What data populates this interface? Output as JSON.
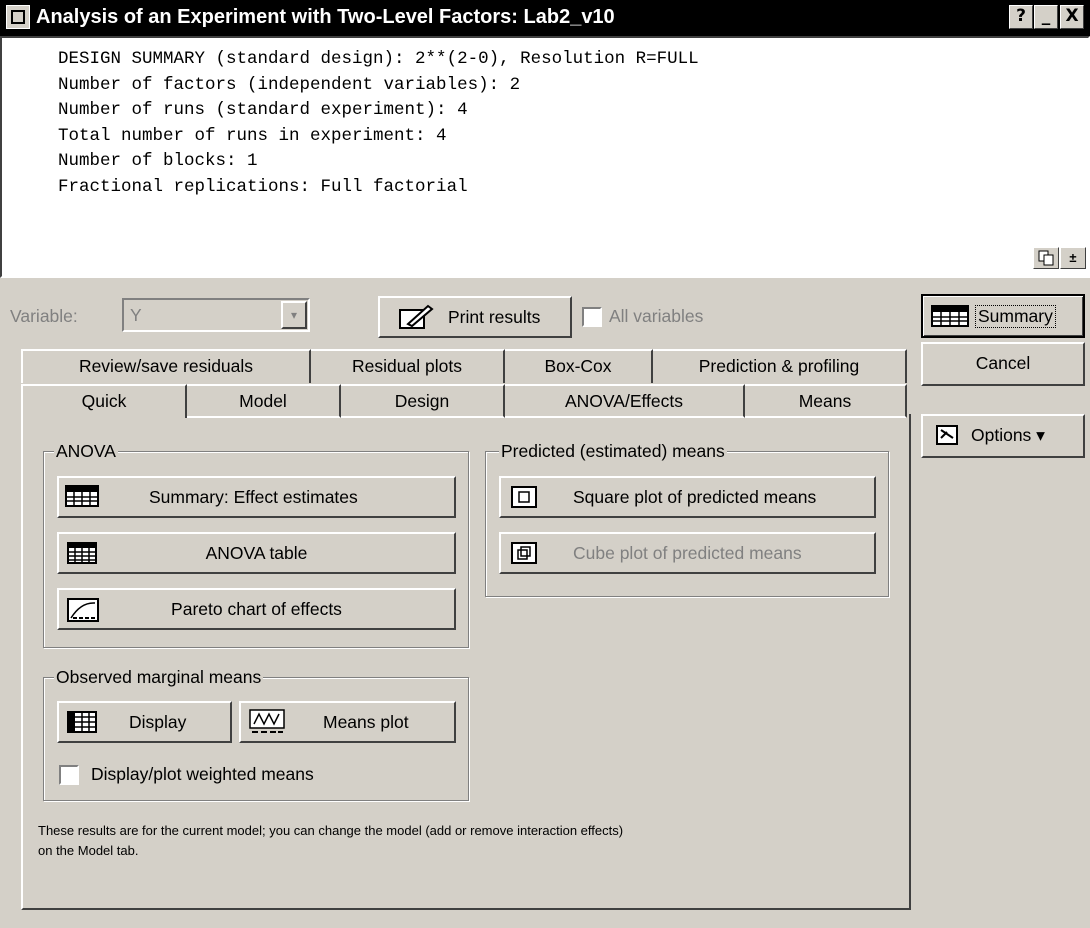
{
  "window": {
    "title": "Analysis of an Experiment with Two-Level Factors: Lab2_v10",
    "help_label": "?",
    "minimize_label": "_",
    "close_label": "X"
  },
  "output": {
    "lines": [
      "DESIGN SUMMARY (standard design): 2**(2-0), Resolution R=FULL",
      "Number of factors (independent variables): 2",
      "Number of runs (standard experiment): 4",
      "Total number of runs in experiment: 4",
      "Number of blocks: 1",
      "Fractional replications: Full factorial"
    ],
    "scroll_label": "±"
  },
  "toolbar": {
    "variable_label": "Variable:",
    "variable_value": "Y",
    "print_label": "Print results",
    "all_variables_label": "All variables"
  },
  "side": {
    "summary_label": "Summary",
    "cancel_label": "Cancel",
    "options_label": "Options ▾"
  },
  "tabs": {
    "back": [
      "Review/save residuals",
      "Residual plots",
      "Box-Cox",
      "Prediction & profiling"
    ],
    "front": [
      "Quick",
      "Model",
      "Design",
      "ANOVA/Effects",
      "Means"
    ],
    "active": "Quick"
  },
  "anova": {
    "title": "ANOVA",
    "summary_label": "Summary:  Effect estimates",
    "table_label": "ANOVA table",
    "pareto_label": "Pareto chart of effects"
  },
  "predicted": {
    "title": "Predicted (estimated) means",
    "square_label": "Square plot of predicted means",
    "cube_label": "Cube plot of predicted means"
  },
  "observed": {
    "title": "Observed marginal means",
    "display_label": "Display",
    "means_plot_label": "Means plot",
    "weighted_label": "Display/plot weighted means"
  },
  "note": {
    "line1": "These results are for the current model; you can change the model (add or remove interaction effects)",
    "line2": "on the Model tab."
  }
}
